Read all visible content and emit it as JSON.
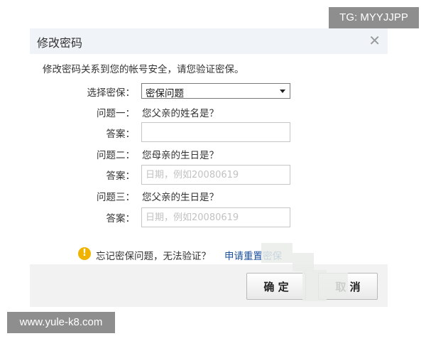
{
  "watermarks": {
    "tg": "TG: MYYJJPP",
    "site": "www.yule-k8.com"
  },
  "dialog": {
    "title": "修改密码",
    "intro": "修改密码关系到您的帐号安全，请您验证密保。",
    "select": {
      "label": "选择密保：",
      "value": "密保问题"
    },
    "questions": [
      {
        "label": "问题一：",
        "text": "您父亲的姓名是？",
        "answer_label": "答案：",
        "placeholder": ""
      },
      {
        "label": "问题二：",
        "text": "您母亲的生日是？",
        "answer_label": "答案：",
        "placeholder": "日期，例如20080619"
      },
      {
        "label": "问题三：",
        "text": "您父亲的生日是？",
        "answer_label": "答案：",
        "placeholder": "日期，例如20080619"
      }
    ],
    "forgot": {
      "text": "忘记密保问题，无法验证？",
      "link": "申请重置密保"
    },
    "buttons": {
      "ok": "确 定",
      "cancel": "取 消"
    }
  },
  "colors": {
    "link": "#1a4f9c",
    "warning": "#f0b400",
    "header_bg": "#f0f3f8"
  },
  "icons": {
    "close": "close-icon",
    "dropdown": "chevron-down-icon",
    "warning": "warning-icon"
  }
}
